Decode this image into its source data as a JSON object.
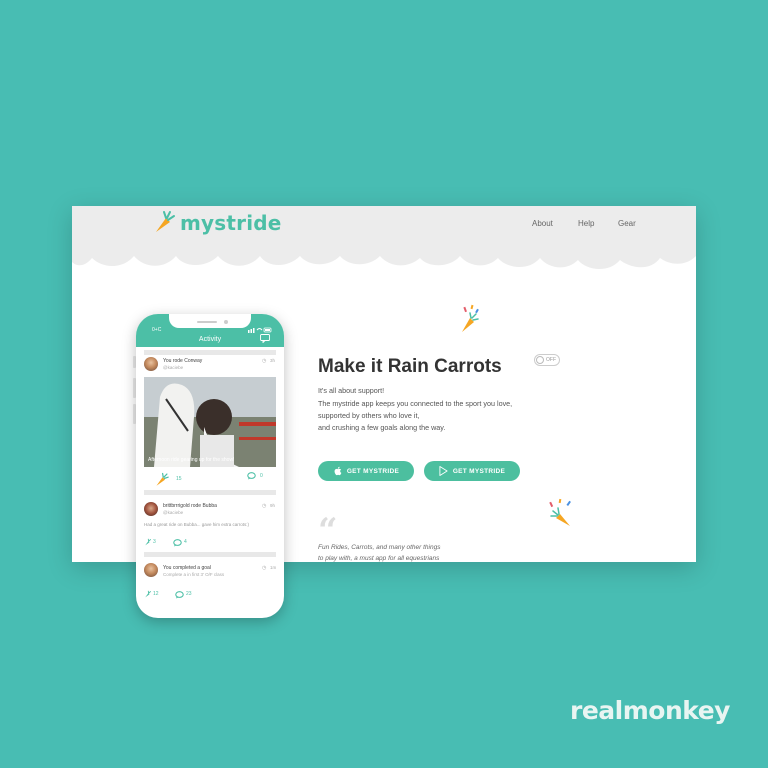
{
  "site": {
    "logo_text": "mystride",
    "nav": [
      "About",
      "Help",
      "Gear"
    ],
    "hero": {
      "title": "Make it Rain Carrots",
      "toggle_label": "OFF",
      "desc": [
        "It's all about support!",
        "The mystride app keeps you connected to the sport you love,",
        "supported by others who love it,",
        "and crushing a few goals along the way."
      ],
      "buttons": [
        "GET MYSTRIDE",
        "GET MYSTRIDE"
      ],
      "quote_mark": "“",
      "quote": [
        "Fun Rides, Carrots, and many other things",
        "to play with, a must app for all equestrians"
      ]
    }
  },
  "phone": {
    "status_time": "0+C",
    "title": "Activity",
    "feed": [
      {
        "name": "You rode Conway",
        "sub": "@kaciebe",
        "time": "3h",
        "caption": "Afternoon ride gearing up for the show!",
        "carrots": "15",
        "comments": "0"
      },
      {
        "name": "brittbrrrigold rode Bubba",
        "sub": "@kaciebe",
        "time": "9h",
        "body": "Had a great ride on Bubba... gave him extra carrots:)",
        "carrots": "3",
        "comments": "4"
      },
      {
        "name": "You completed a goal",
        "sub": "Complete a in first 3' O/F class",
        "time": "1m",
        "carrots": "12",
        "comments": "23"
      }
    ]
  },
  "watermark": "realmonkey",
  "colors": {
    "background": "#48bdb3",
    "brand": "#4cbfa6",
    "carrot": "#f5a623",
    "button": "#4cbf9f"
  },
  "icons": [
    "carrot-icon",
    "apple-icon",
    "play-store-icon",
    "comment-icon",
    "clock-icon",
    "wifi-icon",
    "battery-icon"
  ]
}
